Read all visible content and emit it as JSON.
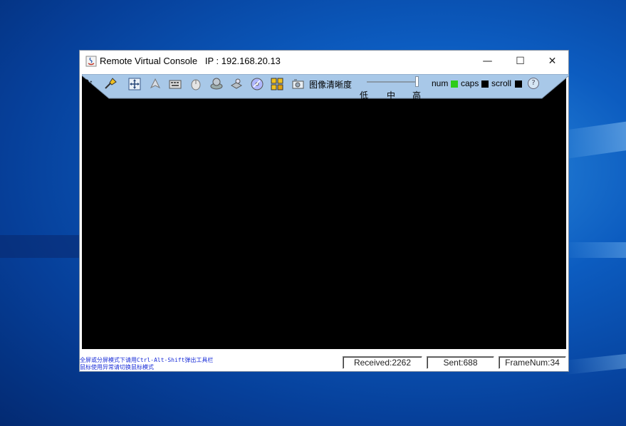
{
  "window": {
    "title": "Remote Virtual Console   IP : 192.168.20.13",
    "minimize_glyph": "—",
    "maximize_glyph": "☐",
    "close_glyph": "✕"
  },
  "toolbar": {
    "pt_label": "P↑",
    "icons": [
      "pin-icon",
      "move-icon",
      "arrow-icon",
      "keyboard-icon",
      "mouse-icon",
      "floppy-drive-icon",
      "hard-drive-icon",
      "cd-drive-icon",
      "network-icon",
      "snapshot-icon"
    ],
    "quality_label": "图像清晰度",
    "quality_ticks": [
      "低",
      "中",
      "高"
    ],
    "quality_level": 1.0,
    "num_label": "num",
    "caps_label": "caps",
    "scroll_label": "scroll",
    "num_on": true,
    "caps_on": false,
    "scroll_on": false,
    "led_on_color": "#2ecc1a",
    "led_off_color": "#000000",
    "help_glyph": "?",
    "toolbar_color": "#a8c8e8"
  },
  "status": {
    "hint_line1": "全屏或分屏模式下请用Ctrl-Alt-Shift弹出工具栏",
    "hint_line2": "鼠标使用异常请切换鼠标模式",
    "received": "Received:2262",
    "sent": "Sent:688",
    "frame": "FrameNum:34"
  }
}
